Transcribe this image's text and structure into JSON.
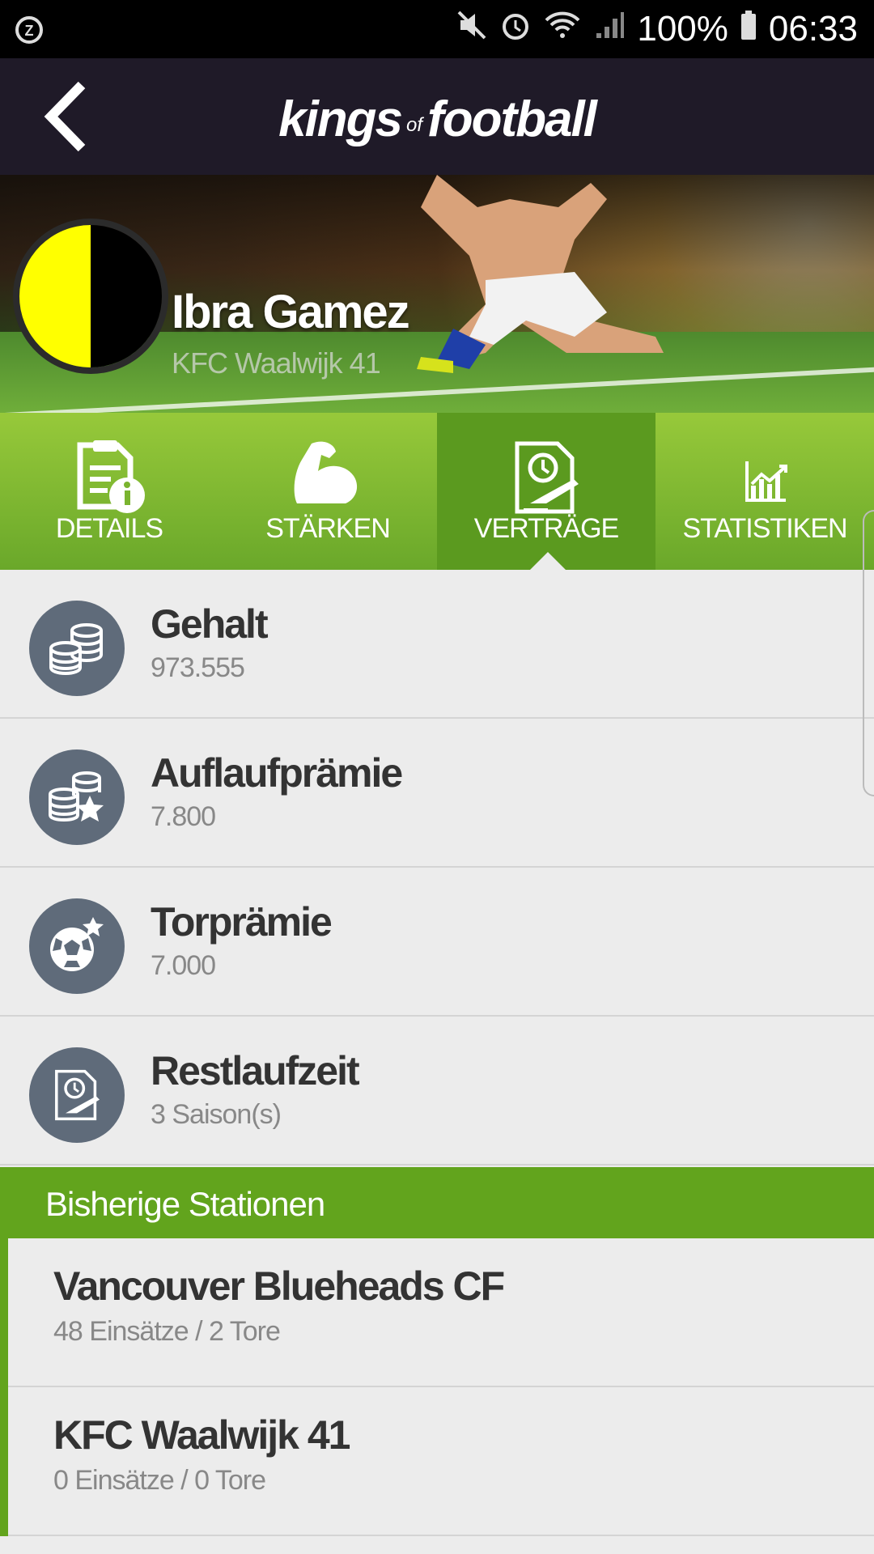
{
  "status_bar": {
    "battery": "100%",
    "time": "06:33",
    "icons": [
      "alarm-app-icon",
      "mute-icon",
      "alarm-icon",
      "wifi-icon",
      "signal-icon",
      "battery-icon"
    ]
  },
  "app_bar": {
    "brand_part1": "kings",
    "brand_of": "of",
    "brand_part2": "football"
  },
  "player": {
    "name": "Ibra Gamez",
    "club": "KFC Waalwijk 41",
    "club_colors": [
      "#ffff00",
      "#000000"
    ]
  },
  "tabs": [
    {
      "label": "DETAILS",
      "icon": "details-document-icon",
      "active": false
    },
    {
      "label": "STÄRKEN",
      "icon": "flexed-arm-icon",
      "active": false
    },
    {
      "label": "VERTRÄGE",
      "icon": "contract-icon",
      "active": true
    },
    {
      "label": "STATISTIKEN",
      "icon": "bar-chart-icon",
      "active": false
    }
  ],
  "contract": [
    {
      "title": "Gehalt",
      "value": "973.555",
      "icon": "coins-icon"
    },
    {
      "title": "Auflaufprämie",
      "value": "7.800",
      "icon": "coins-star-icon"
    },
    {
      "title": "Torprämie",
      "value": "7.000",
      "icon": "ball-star-icon"
    },
    {
      "title": "Restlaufzeit",
      "value": "3 Saison(s)",
      "icon": "contract-clock-icon"
    }
  ],
  "stations_header": "Bisherige Stationen",
  "stations": [
    {
      "club": "Vancouver Blueheads CF",
      "stats": "48 Einsätze / 2 Tore"
    },
    {
      "club": "KFC Waalwijk 41",
      "stats": "0 Einsätze / 0 Tore"
    }
  ],
  "colors": {
    "app_bar": "#1f1a28",
    "tab_green": "#6aa82a",
    "tab_active": "#5b9a1f",
    "section_green": "#62a41d",
    "icon_circle": "#5f6b7a"
  }
}
